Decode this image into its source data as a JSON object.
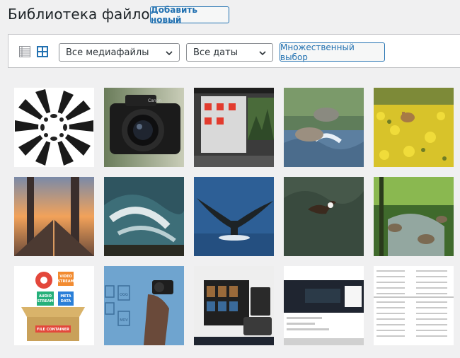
{
  "header": {
    "title": "Библиотека файлов",
    "add_new_label": "Добавить новый"
  },
  "toolbar": {
    "view_modes": [
      "list-view-icon",
      "grid-view-icon"
    ],
    "active_view": "grid",
    "media_type_filter": "Все медиафайлы",
    "date_filter": "Все даты",
    "bulk_select_label": "Множественный выбор"
  },
  "media_grid": {
    "items": [
      {
        "subject": "butterfly-kaleidoscope-pattern"
      },
      {
        "subject": "canon-camera-with-lens"
      },
      {
        "subject": "software-window-screenshot"
      },
      {
        "subject": "river-with-rocks"
      },
      {
        "subject": "deer-in-yellow-flowers"
      },
      {
        "subject": "bridge-at-sunset"
      },
      {
        "subject": "ocean-wave"
      },
      {
        "subject": "whale-tail"
      },
      {
        "subject": "eagle-flying-over-forest"
      },
      {
        "subject": "forest-stream"
      },
      {
        "subject": "file-container-illustration"
      },
      {
        "subject": "hand-with-camera-file-icons"
      },
      {
        "subject": "video-app-screenshot"
      },
      {
        "subject": "web-page-screenshot"
      },
      {
        "subject": "file-properties-table"
      }
    ],
    "illustration_labels": {
      "video_stream": "VIDEO\nSTREAM",
      "audio_stream": "AUDIO\nSTREAM",
      "meta_data": "META\nDATA",
      "file_container": "FILE CONTAINER",
      "ogg": "OGG",
      "mov": "MOV"
    }
  },
  "colors": {
    "accent": "#2271b1",
    "background": "#f0f0f1",
    "border": "#c3c4c7"
  }
}
